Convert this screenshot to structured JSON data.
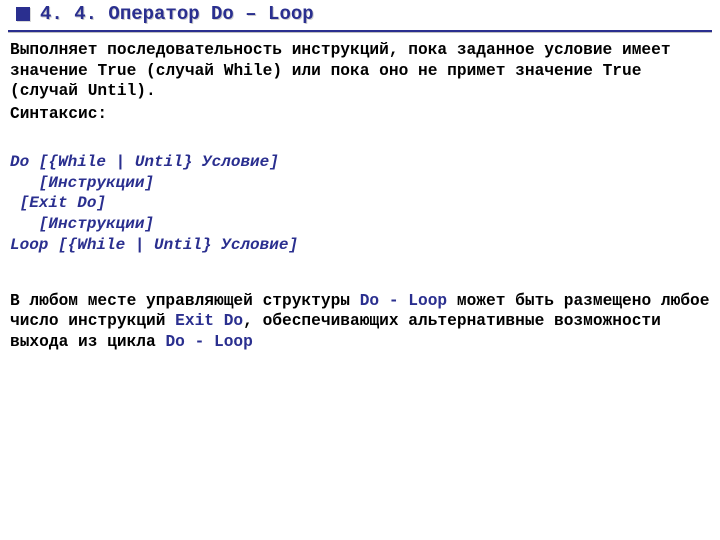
{
  "header": {
    "title": "4. 4. Оператор Do – Loop"
  },
  "intro": {
    "p1_a": "Выполняет последовательность инструкций, пока заданное условие имеет значение ",
    "true1": "True",
    "p1_b": " (случай ",
    "while": "While",
    "p1_c": ") или пока оно не примет значение ",
    "true2": "True",
    "p1_d": " (случай ",
    "until": "Until",
    "p1_e": ")."
  },
  "syntax_label": "Синтаксис:",
  "syntax": {
    "l1": "Do [{While | Until} Условие]",
    "l2": "   [Инструкции]",
    "l3": " [Exit Do]",
    "l4": "   [Инструкции]",
    "l5": "Loop [{While | Until} Условие]"
  },
  "para2": {
    "a": "В любом месте управляющей структуры ",
    "doloop1": "Do - Loop",
    "b": " может быть размещено любое число инструкций ",
    "exitdo": "Exit Do",
    "c": ", обеспечивающих альтернативные возможности выхода из цикла ",
    "doloop2": "Do - Loop"
  }
}
